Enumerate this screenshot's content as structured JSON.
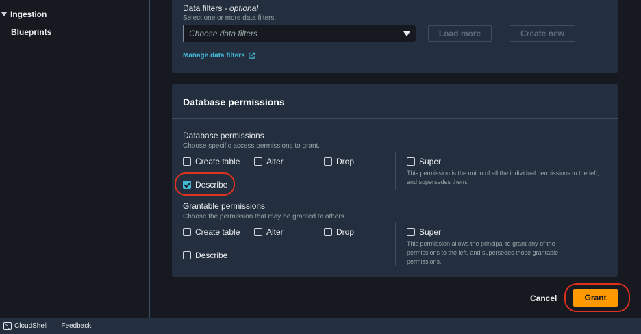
{
  "sidebar": {
    "section_label": "Ingestion",
    "items": [
      {
        "label": "Blueprints"
      }
    ]
  },
  "data_filters": {
    "label": "Data filters - ",
    "optional": "optional",
    "description": "Select one or more data filters.",
    "select_placeholder": "Choose data filters",
    "load_more_label": "Load more",
    "create_new_label": "Create new",
    "manage_link": "Manage data filters"
  },
  "database_permissions": {
    "panel_title": "Database permissions",
    "group_label": "Database permissions",
    "group_description": "Choose specific access permissions to grant.",
    "options": [
      {
        "label": "Create table",
        "checked": false
      },
      {
        "label": "Alter",
        "checked": false
      },
      {
        "label": "Drop",
        "checked": false
      },
      {
        "label": "Describe",
        "checked": true
      }
    ],
    "super": {
      "label": "Super",
      "checked": false,
      "description": "This permission is the union of all the individual permissions to the left, and supersedes them."
    }
  },
  "grantable_permissions": {
    "label": "Grantable permissions",
    "description": "Choose the permission that may be granted to others.",
    "options": [
      {
        "label": "Create table",
        "checked": false
      },
      {
        "label": "Alter",
        "checked": false
      },
      {
        "label": "Drop",
        "checked": false
      },
      {
        "label": "Describe",
        "checked": false
      }
    ],
    "super": {
      "label": "Super",
      "checked": false,
      "description": "This permission allows the principal to grant any of the permissions to the left, and supersedes those grantable permissions."
    }
  },
  "actions": {
    "cancel_label": "Cancel",
    "grant_label": "Grant"
  },
  "bottom_bar": {
    "cloudshell_label": "CloudShell",
    "feedback_label": "Feedback"
  },
  "colors": {
    "accent": "#ff9900",
    "link": "#44b9d6",
    "highlight": "#e0301e"
  }
}
